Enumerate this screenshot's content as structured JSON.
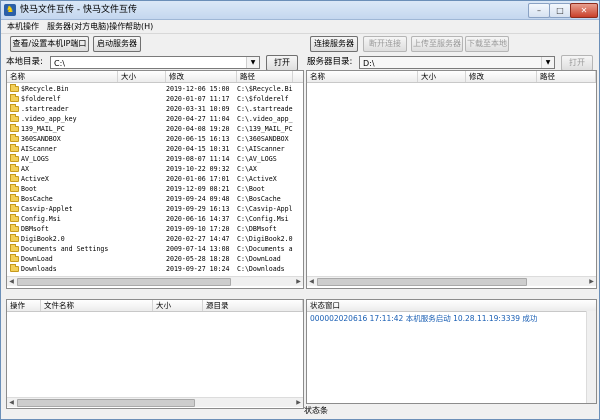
{
  "window": {
    "title": "快马文件互传 - 快马文件互传"
  },
  "menu": [
    "本机操作",
    "服务器(对方电脑)操作",
    "帮助(H)"
  ],
  "toolbar_left": {
    "view_ip": "查看/设置本机IP端口",
    "start_server": "启动服务器"
  },
  "toolbar_right": {
    "connect": "连接服务器",
    "disconnect": "断开连接",
    "upload": "上传至服务器",
    "download": "下载至本地"
  },
  "local": {
    "label": "本地目录:",
    "path": "C:\\",
    "open": "打开",
    "columns": [
      "名称",
      "大小",
      "修改",
      "路径"
    ],
    "files": [
      {
        "name": "$Recycle.Bin",
        "size": "",
        "date": "2019-12-06 15:00",
        "path": "C:\\$Recycle.Bin"
      },
      {
        "name": "$folderelf",
        "size": "",
        "date": "2020-01-07 11:17",
        "path": "C:\\$folderelf"
      },
      {
        "name": ".startreader",
        "size": "",
        "date": "2020-03-31 10:09",
        "path": "C:\\.startreader"
      },
      {
        "name": ".video_app_key",
        "size": "",
        "date": "2020-04-27 11:04",
        "path": "C:\\.video_app_k"
      },
      {
        "name": "139_MAIL_PC",
        "size": "",
        "date": "2020-04-08 19:20",
        "path": "C:\\139_MAIL_PC"
      },
      {
        "name": "360SANDBOX",
        "size": "",
        "date": "2020-06-15 16:13",
        "path": "C:\\360SANDBOX"
      },
      {
        "name": "AIScanner",
        "size": "",
        "date": "2020-04-15 10:31",
        "path": "C:\\AIScanner"
      },
      {
        "name": "AV_LOGS",
        "size": "",
        "date": "2019-08-07 11:14",
        "path": "C:\\AV_LOGS"
      },
      {
        "name": "AX",
        "size": "",
        "date": "2019-10-22 09:32",
        "path": "C:\\AX"
      },
      {
        "name": "ActiveX",
        "size": "",
        "date": "2020-01-06 17:01",
        "path": "C:\\ActiveX"
      },
      {
        "name": "Boot",
        "size": "",
        "date": "2019-12-09 08:21",
        "path": "C:\\Boot"
      },
      {
        "name": "BosCache",
        "size": "",
        "date": "2019-09-24 09:48",
        "path": "C:\\BosCache"
      },
      {
        "name": "Casvip-Applet",
        "size": "",
        "date": "2019-09-29 16:13",
        "path": "C:\\Casvip-Apple"
      },
      {
        "name": "Config.Msi",
        "size": "",
        "date": "2020-06-16 14:37",
        "path": "C:\\Config.Msi"
      },
      {
        "name": "DBMsoft",
        "size": "",
        "date": "2019-09-10 17:20",
        "path": "C:\\DBMsoft"
      },
      {
        "name": "DigiBook2.0",
        "size": "",
        "date": "2020-02-27 14:47",
        "path": "C:\\DigiBook2.0"
      },
      {
        "name": "Documents and Settings",
        "size": "",
        "date": "2009-07-14 13:08",
        "path": "C:\\Documents an"
      },
      {
        "name": "DownLoad",
        "size": "",
        "date": "2020-05-28 18:28",
        "path": "C:\\DownLoad"
      },
      {
        "name": "Downloads",
        "size": "",
        "date": "2019-09-27 10:24",
        "path": "C:\\Downloads"
      }
    ]
  },
  "server": {
    "label": "服务器目录:",
    "path": "D:\\",
    "open": "打开",
    "columns": [
      "名称",
      "大小",
      "修改",
      "路径"
    ]
  },
  "transfer": {
    "columns": [
      "操作",
      "文件名称",
      "大小",
      "源目录"
    ]
  },
  "status_window": {
    "title": "状态窗口",
    "lines": [
      "000002020616 17:11:42 本机服务启动 10.28.11.19:3339 成功"
    ]
  },
  "status_bar": "状态条"
}
